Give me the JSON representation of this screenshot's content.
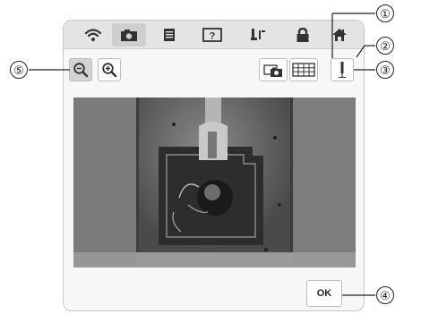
{
  "tabs": [
    {
      "icon": "wifi-icon",
      "active": false
    },
    {
      "icon": "camera-icon",
      "active": true
    },
    {
      "icon": "document-icon",
      "active": false
    },
    {
      "icon": "help-icon",
      "active": false,
      "label": "?"
    },
    {
      "icon": "embroidery-foot-icon",
      "active": false
    },
    {
      "icon": "lock-icon",
      "active": false
    },
    {
      "icon": "home-icon",
      "active": false
    }
  ],
  "toolbar": {
    "zoom_out_icon": "zoom-out-icon",
    "zoom_in_icon": "zoom-in-icon",
    "camera_button_icon": "camera-snapshot-icon",
    "grid_button_icon": "grid-icon",
    "needle_button_icon": "needle-icon"
  },
  "ok_label": "OK",
  "callouts": [
    "①",
    "②",
    "③",
    "④",
    "⑤"
  ],
  "colors": {
    "frame": "#c6c6c6",
    "tabbar": "#e4e4e4",
    "selected": "#d2d2d2",
    "preview": "#6e6e6e"
  }
}
